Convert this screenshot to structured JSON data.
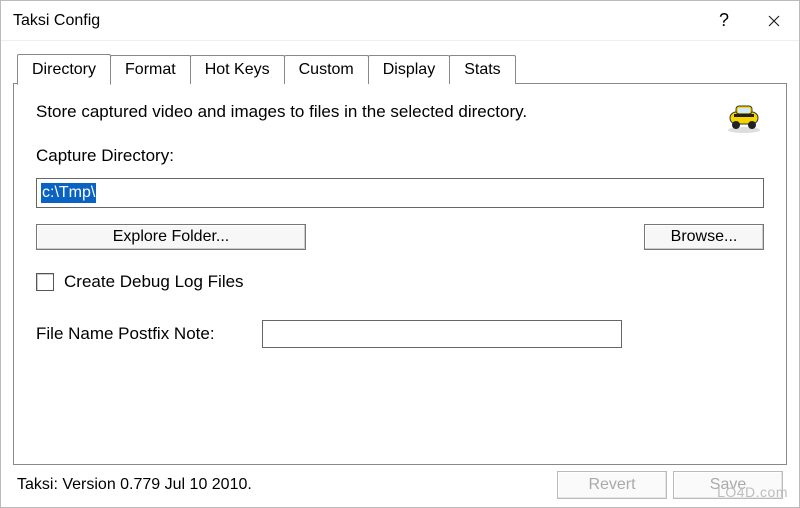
{
  "window": {
    "title": "Taksi Config"
  },
  "tabs": [
    {
      "label": "Directory",
      "active": true
    },
    {
      "label": "Format",
      "active": false
    },
    {
      "label": "Hot Keys",
      "active": false
    },
    {
      "label": "Custom",
      "active": false
    },
    {
      "label": "Display",
      "active": false
    },
    {
      "label": "Stats",
      "active": false
    }
  ],
  "panel": {
    "description": "Store captured video and images to files in the selected directory.",
    "capture_dir_label": "Capture Directory:",
    "capture_dir_value": "c:\\Tmp\\",
    "explore_btn": "Explore Folder...",
    "browse_btn": "Browse...",
    "debug_log_label": "Create Debug Log Files",
    "debug_log_checked": false,
    "postfix_label": "File Name Postfix Note:",
    "postfix_value": ""
  },
  "footer": {
    "version": "Taksi: Version 0.779 Jul 10 2010.",
    "revert_btn": "Revert",
    "save_btn": "Save"
  },
  "watermark": "LO4D.com"
}
